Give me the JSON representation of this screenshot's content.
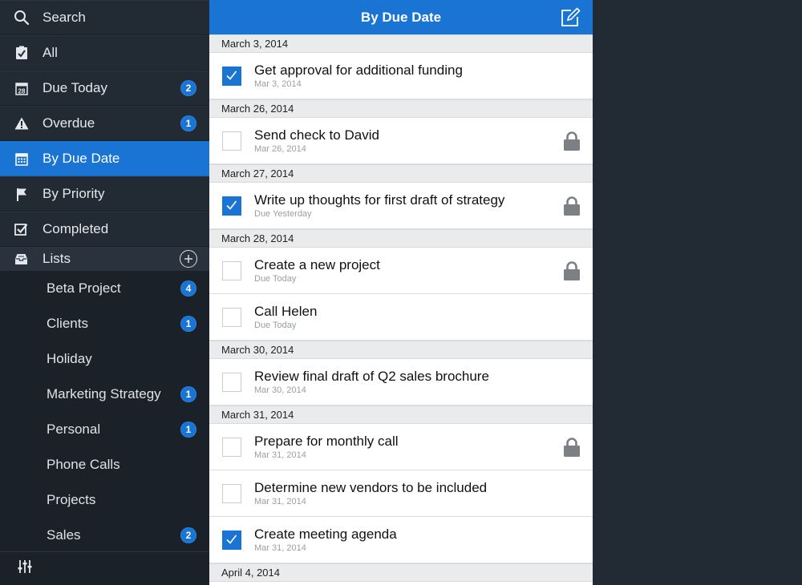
{
  "sidebar": {
    "search_label": "Search",
    "nav": [
      {
        "label": "All",
        "icon": "clipboard-check-icon"
      },
      {
        "label": "Due Today",
        "icon": "calendar-28-icon",
        "badge": "2"
      },
      {
        "label": "Overdue",
        "icon": "warning-icon",
        "badge": "1"
      },
      {
        "label": "By Due Date",
        "icon": "calendar-icon",
        "active": true
      },
      {
        "label": "By Priority",
        "icon": "flag-icon"
      },
      {
        "label": "Completed",
        "icon": "checkbox-icon"
      }
    ],
    "lists_label": "Lists",
    "lists": [
      {
        "label": "Beta Project",
        "badge": "4"
      },
      {
        "label": "Clients",
        "badge": "1"
      },
      {
        "label": "Holiday",
        "badge": ""
      },
      {
        "label": "Marketing Strategy",
        "badge": "1"
      },
      {
        "label": "Personal",
        "badge": "1"
      },
      {
        "label": "Phone Calls",
        "badge": ""
      },
      {
        "label": "Projects",
        "badge": ""
      },
      {
        "label": "Sales",
        "badge": "2"
      }
    ],
    "footer_icon": "sliders-icon"
  },
  "main": {
    "title": "By Due Date",
    "groups": [
      {
        "date": "March 3, 2014",
        "tasks": [
          {
            "title": "Get approval for additional funding",
            "sub": "Mar 3, 2014",
            "checked": true,
            "locked": false
          }
        ]
      },
      {
        "date": "March 26, 2014",
        "tasks": [
          {
            "title": "Send check to David",
            "sub": "Mar 26, 2014",
            "checked": false,
            "locked": true
          }
        ]
      },
      {
        "date": "March 27, 2014",
        "tasks": [
          {
            "title": "Write up thoughts for first draft of strategy",
            "sub": "Due Yesterday",
            "checked": true,
            "locked": true
          }
        ]
      },
      {
        "date": "March 28, 2014",
        "tasks": [
          {
            "title": "Create a new project",
            "sub": "Due Today",
            "checked": false,
            "locked": true
          },
          {
            "title": "Call Helen",
            "sub": "Due Today",
            "checked": false,
            "locked": false
          }
        ]
      },
      {
        "date": "March 30, 2014",
        "tasks": [
          {
            "title": "Review final draft of Q2 sales brochure",
            "sub": "Mar 30, 2014",
            "checked": false,
            "locked": false
          }
        ]
      },
      {
        "date": "March 31, 2014",
        "tasks": [
          {
            "title": "Prepare for monthly call",
            "sub": "Mar 31, 2014",
            "checked": false,
            "locked": true
          },
          {
            "title": "Determine new vendors to be included",
            "sub": "Mar 31, 2014",
            "checked": false,
            "locked": false
          },
          {
            "title": "Create meeting agenda",
            "sub": "Mar 31, 2014",
            "checked": true,
            "locked": false
          }
        ]
      },
      {
        "date": "April 4, 2014",
        "tasks": []
      }
    ]
  },
  "colors": {
    "accent": "#1a74d3",
    "sidebar_bg": "#222a33",
    "lock": "#7c7f83"
  }
}
